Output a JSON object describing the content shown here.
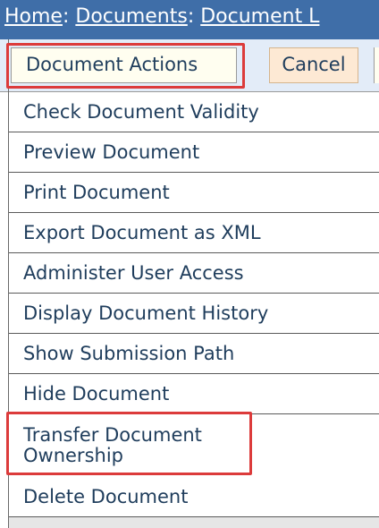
{
  "breadcrumb": {
    "items": [
      "Home",
      "Documents",
      "Document L"
    ],
    "separator": ": "
  },
  "toolbar": {
    "actions_label": "Document Actions",
    "cancel_label": "Cancel"
  },
  "menu": {
    "items": [
      "Check Document Validity",
      "Preview Document",
      "Print Document",
      "Export Document as XML",
      "Administer User Access",
      "Display Document History",
      "Show Submission Path",
      "Hide Document",
      "Transfer Document Ownership",
      "Delete Document"
    ]
  },
  "colors": {
    "breadcrumb_bg": "#3f6ea8",
    "link_text": "#1f3d5c",
    "highlight": "#dc3b3b",
    "cancel_bg": "#fde9d4"
  }
}
